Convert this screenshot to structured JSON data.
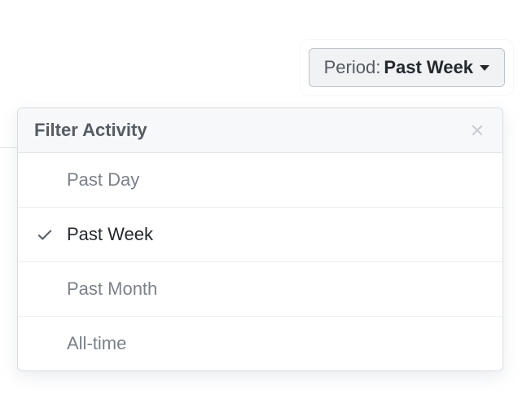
{
  "dropdown": {
    "label": "Period:",
    "value": "Past Week"
  },
  "panel": {
    "title": "Filter Activity",
    "options": [
      {
        "label": "Past Day",
        "selected": false
      },
      {
        "label": "Past Week",
        "selected": true
      },
      {
        "label": "Past Month",
        "selected": false
      },
      {
        "label": "All-time",
        "selected": false
      }
    ]
  }
}
